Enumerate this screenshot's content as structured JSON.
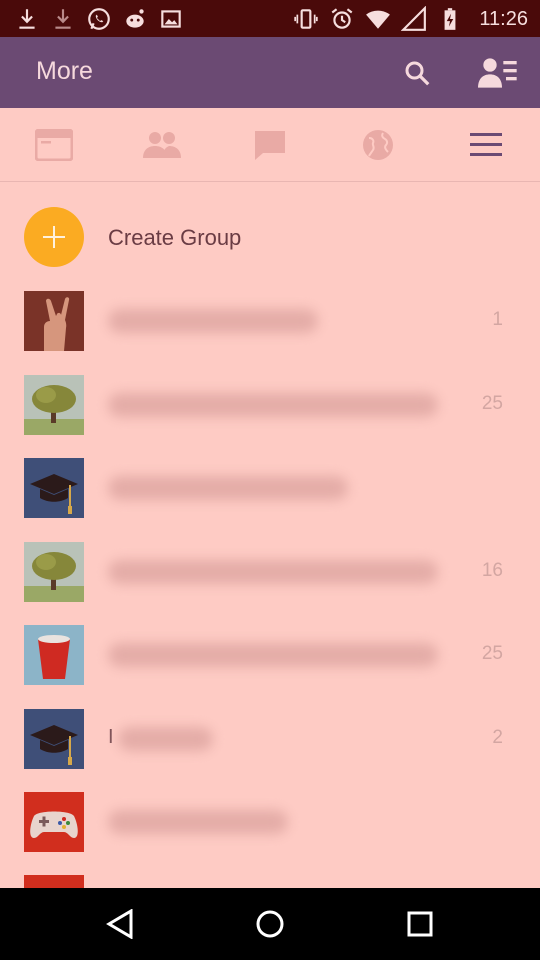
{
  "status_bar": {
    "time": "11:26",
    "icons": [
      "download-icon",
      "download-icon",
      "whatsapp-icon",
      "reddit-icon",
      "image-icon",
      "vibrate-icon",
      "alarm-icon",
      "wifi-icon",
      "signal-icon",
      "battery-charging-icon"
    ]
  },
  "app_bar": {
    "title": "More",
    "actions": [
      "search-icon",
      "contacts-menu-icon"
    ]
  },
  "tabs": [
    "news-icon",
    "people-icon",
    "chat-icon",
    "globe-icon",
    "menu-icon"
  ],
  "create_group": {
    "label": "Create Group"
  },
  "groups": [
    {
      "avatar": "rock-hand",
      "count": "1",
      "visible_text": ""
    },
    {
      "avatar": "tree",
      "count": "25",
      "visible_text": ""
    },
    {
      "avatar": "graduation-cap",
      "count": "",
      "visible_text": ""
    },
    {
      "avatar": "tree",
      "count": "16",
      "visible_text": ""
    },
    {
      "avatar": "red-cup",
      "count": "25",
      "visible_text": ""
    },
    {
      "avatar": "graduation-cap",
      "count": "2",
      "visible_text": "I"
    },
    {
      "avatar": "game-controller",
      "count": "",
      "visible_text": ""
    }
  ],
  "colors": {
    "status_bar": "#4a0a0a",
    "app_bar": "#6b4a73",
    "background": "#fecbc4",
    "accent": "#fbab22"
  }
}
